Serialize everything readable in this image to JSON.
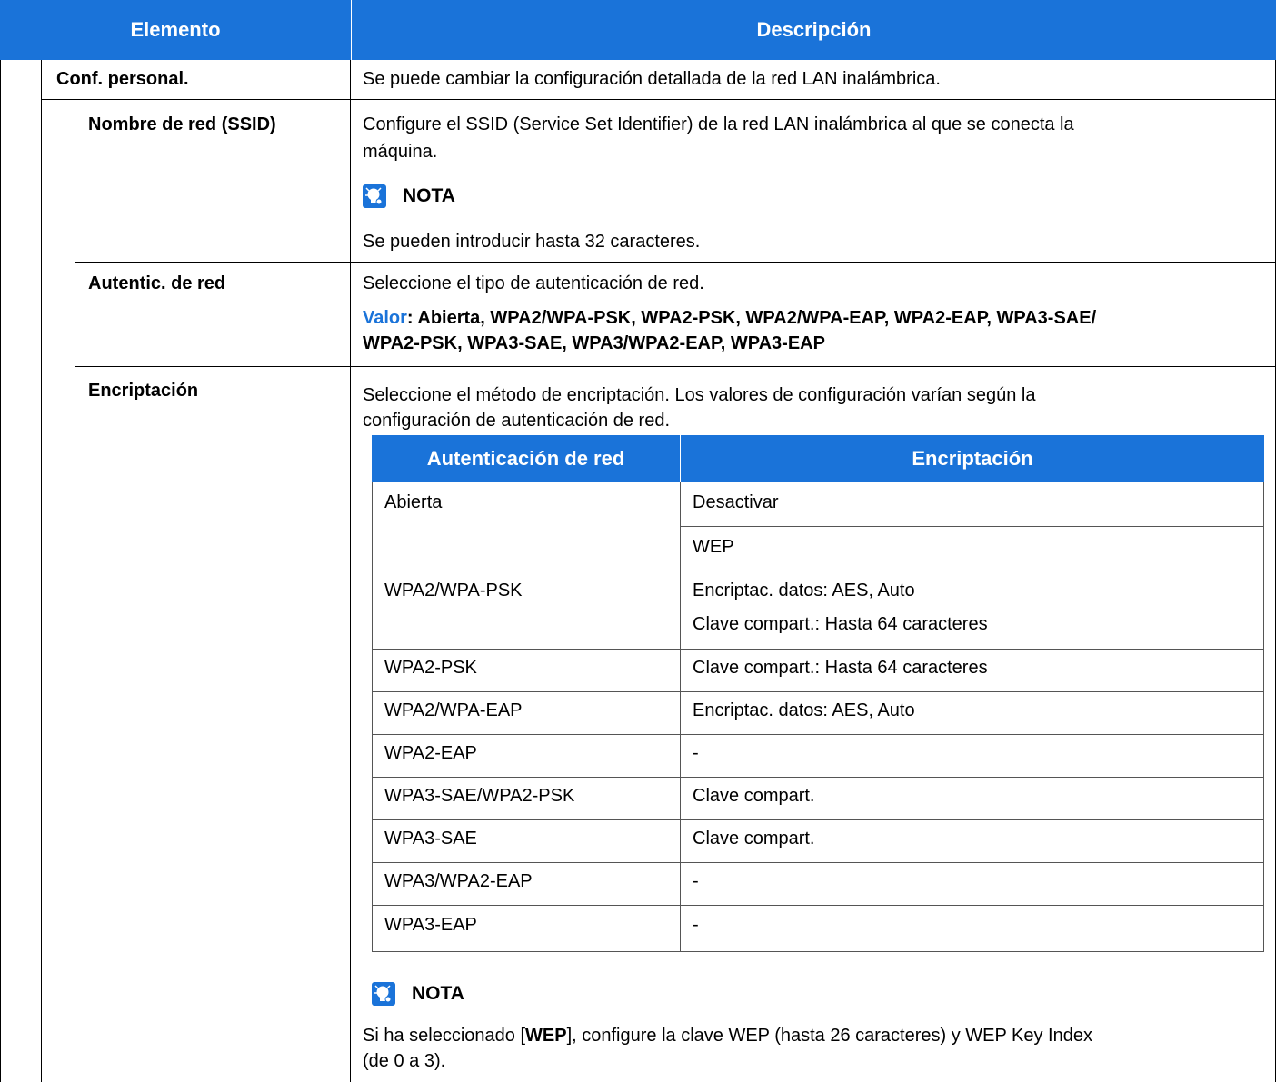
{
  "header": {
    "col1": "Elemento",
    "col2": "Descripción"
  },
  "rows": {
    "conf": {
      "label": "Conf. personal.",
      "desc": "Se puede cambiar la configuración detallada de la red LAN inalámbrica."
    },
    "ssid": {
      "label": "Nombre de red (SSID)",
      "desc1": "Configure el SSID (Service Set Identifier) de la red LAN inalámbrica al que se conecta la",
      "desc2": "máquina.",
      "note_title": "NOTA",
      "note_text": "Se pueden introducir hasta 32 caracteres."
    },
    "auth": {
      "label": "Autentic. de red",
      "desc": "Seleccione el tipo de autenticación de red.",
      "value_label": "Valor",
      "value_line1": ": Abierta, WPA2/WPA-PSK, WPA2-PSK, WPA2/WPA-EAP, WPA2-EAP, WPA3-SAE/",
      "value_line2": "WPA2-PSK, WPA3-SAE, WPA3/WPA2-EAP, WPA3-EAP"
    },
    "enc": {
      "label": "Encriptación",
      "desc1": "Seleccione el método de encriptación. Los valores de configuración varían según la",
      "desc2": "configuración de autenticación de red.",
      "table_header": {
        "col1": "Autenticación de red",
        "col2": "Encriptación"
      },
      "table": [
        {
          "auth": "Abierta",
          "enc": [
            "Desactivar",
            "WEP"
          ]
        },
        {
          "auth": "WPA2/WPA-PSK",
          "enc": [
            "Encriptac. datos: AES, Auto",
            "Clave compart.: Hasta 64 caracteres"
          ]
        },
        {
          "auth": "WPA2-PSK",
          "enc": [
            "Clave compart.: Hasta 64 caracteres"
          ]
        },
        {
          "auth": "WPA2/WPA-EAP",
          "enc": [
            "Encriptac. datos: AES, Auto"
          ]
        },
        {
          "auth": "WPA2-EAP",
          "enc": [
            "-"
          ]
        },
        {
          "auth": "WPA3-SAE/WPA2-PSK",
          "enc": [
            "Clave compart."
          ]
        },
        {
          "auth": "WPA3-SAE",
          "enc": [
            "Clave compart."
          ]
        },
        {
          "auth": "WPA3/WPA2-EAP",
          "enc": [
            "-"
          ]
        },
        {
          "auth": "WPA3-EAP",
          "enc": [
            "-"
          ]
        }
      ],
      "note_title": "NOTA",
      "note_pre": "Si ha seleccionado [",
      "note_bold": "WEP",
      "note_post": "], configure la clave WEP (hasta 26 caracteres) y WEP Key Index",
      "note_line2": "(de 0 a 3)."
    }
  },
  "icons": {
    "note": "lightbulb-note-icon"
  },
  "colors": {
    "header_bg": "#1a73d9",
    "note_icon": "#1a73d9"
  }
}
